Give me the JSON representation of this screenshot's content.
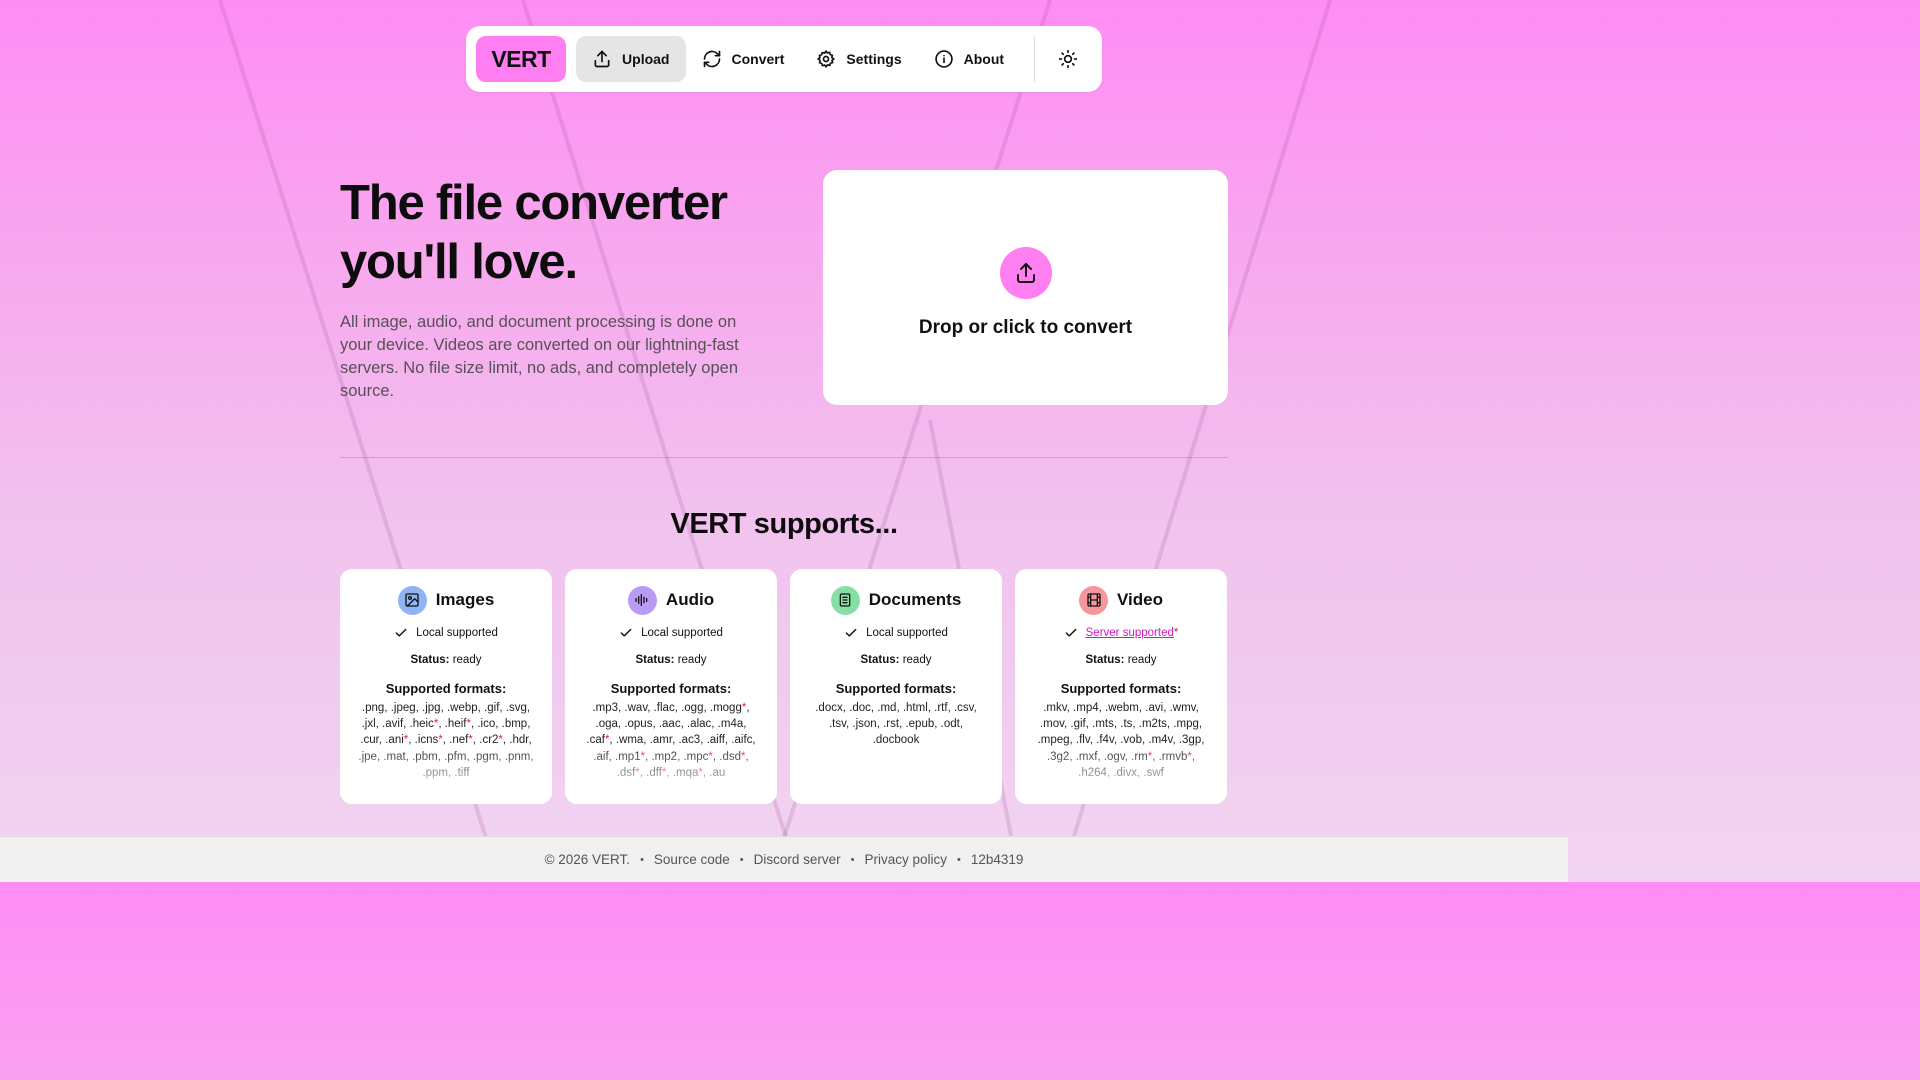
{
  "nav": {
    "logo": "VERT",
    "items": [
      {
        "label": "Upload",
        "icon": "upload-icon"
      },
      {
        "label": "Convert",
        "icon": "refresh-icon"
      },
      {
        "label": "Settings",
        "icon": "gear-icon"
      },
      {
        "label": "About",
        "icon": "info-icon"
      }
    ],
    "theme_icon": "sun-icon"
  },
  "hero": {
    "title_line1": "The file converter",
    "title_line2": "you'll love.",
    "description": "All image, audio, and document processing is done on your device. Videos are converted on our lightning-fast servers. No file size limit, no ads, and completely open source."
  },
  "dropzone": {
    "label": "Drop or click to convert",
    "icon": "upload-icon"
  },
  "supports": {
    "title": "VERT supports..."
  },
  "cards": [
    {
      "title": "Images",
      "icon": "image-icon",
      "accent": "#8fb3f5",
      "support": "Local supported",
      "status_label": "Status:",
      "status": "ready",
      "formats_heading": "Supported formats:",
      "formats": [
        ".png",
        ".jpeg",
        ".jpg",
        ".webp",
        ".gif",
        ".svg",
        ".jxl",
        ".avif",
        ".heic*",
        ".heif*",
        ".ico",
        ".bmp",
        ".cur",
        ".ani*",
        ".icns*",
        ".nef*",
        ".cr2*",
        ".hdr",
        ".jpe",
        ".mat",
        ".pbm",
        ".pfm",
        ".pgm",
        ".pnm",
        ".ppm",
        ".tiff"
      ]
    },
    {
      "title": "Audio",
      "icon": "audio-wave-icon",
      "accent": "#b99af7",
      "support": "Local supported",
      "status_label": "Status:",
      "status": "ready",
      "formats_heading": "Supported formats:",
      "formats": [
        ".mp3",
        ".wav",
        ".flac",
        ".ogg",
        ".mogg*",
        ".oga",
        ".opus",
        ".aac",
        ".alac",
        ".m4a",
        ".caf*",
        ".wma",
        ".amr",
        ".ac3",
        ".aiff",
        ".aifc",
        ".aif",
        ".mp1*",
        ".mp2",
        ".mpc*",
        ".dsd*",
        ".dsf*",
        ".dff*",
        ".mqa*",
        ".au"
      ]
    },
    {
      "title": "Documents",
      "icon": "document-icon",
      "accent": "#86e0a6",
      "support": "Local supported",
      "status_label": "Status:",
      "status": "ready",
      "formats_heading": "Supported formats:",
      "formats": [
        ".docx",
        ".doc",
        ".md",
        ".html",
        ".rtf",
        ".csv",
        ".tsv",
        ".json",
        ".rst",
        ".epub",
        ".odt",
        ".docbook"
      ]
    },
    {
      "title": "Video",
      "icon": "film-icon",
      "accent": "#f5959c",
      "support": "Server supported",
      "status_label": "Status:",
      "status": "ready",
      "formats_heading": "Supported formats:",
      "formats": [
        ".mkv",
        ".mp4",
        ".webm",
        ".avi",
        ".wmv",
        ".mov",
        ".gif",
        ".mts",
        ".ts",
        ".m2ts",
        ".mpg",
        ".mpeg",
        ".flv",
        ".f4v",
        ".vob",
        ".m4v",
        ".3gp",
        ".3g2",
        ".mxf",
        ".ogv",
        ".rm*",
        ".rmvb*",
        ".h264",
        ".divx",
        ".swf"
      ]
    }
  ],
  "footer": {
    "copyright": "© 2026 VERT.",
    "links": [
      "Source code",
      "Discord server",
      "Privacy policy"
    ],
    "version": "12b4319"
  },
  "colors": {
    "brand": "#ff7ef1",
    "link": "#d316c4",
    "asterisk": "#e0243c"
  }
}
